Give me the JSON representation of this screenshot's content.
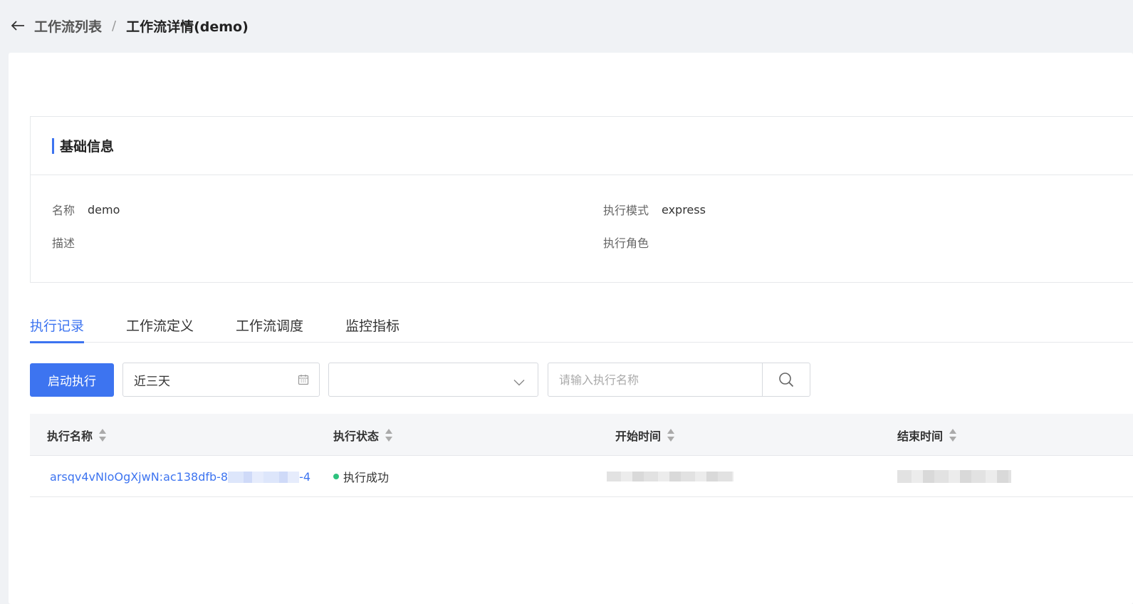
{
  "breadcrumb": {
    "back_icon": "arrow-left-icon",
    "parent": "工作流列表",
    "separator": "/",
    "current": "工作流详情(demo)"
  },
  "basic_info": {
    "title": "基础信息",
    "fields": {
      "name_label": "名称",
      "name_value": "demo",
      "mode_label": "执行模式",
      "mode_value": "express",
      "desc_label": "描述",
      "desc_value": "",
      "role_label": "执行角色",
      "role_value": ""
    }
  },
  "tabs": [
    {
      "label": "执行记录",
      "active": true
    },
    {
      "label": "工作流定义",
      "active": false
    },
    {
      "label": "工作流调度",
      "active": false
    },
    {
      "label": "监控指标",
      "active": false
    }
  ],
  "toolbar": {
    "start_button": "启动执行",
    "date_range_value": "近三天",
    "status_select_value": "",
    "search_placeholder": "请输入执行名称"
  },
  "table": {
    "columns": [
      "执行名称",
      "执行状态",
      "开始时间",
      "结束时间"
    ],
    "rows": [
      {
        "name": "arsqv4vNIoOgXjwN:ac138dfb-8",
        "status": "执行成功",
        "status_color": "#2ec27e"
      }
    ]
  },
  "colors": {
    "accent": "#3d74f0",
    "success": "#2ec27e",
    "background": "#f0f2f5"
  }
}
